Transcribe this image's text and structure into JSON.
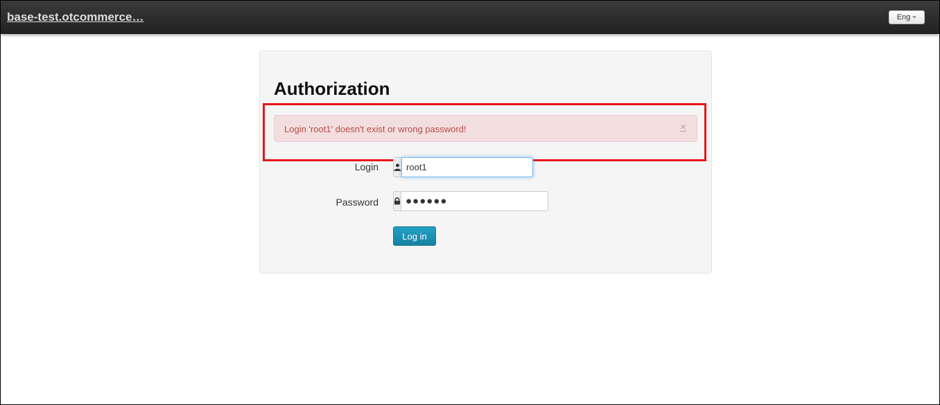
{
  "header": {
    "brand": "base-test.otcommerce…",
    "language": "Eng",
    "language_icon": "caret-down-icon"
  },
  "form": {
    "title": "Authorization",
    "alert": {
      "message": "Login 'root1' doesn't exist or wrong password!",
      "close": "×",
      "close_icon": "close-icon"
    },
    "login": {
      "label": "Login",
      "value": "root1",
      "icon": "user-icon"
    },
    "password": {
      "label": "Password",
      "value": "●●●●●●",
      "icon": "lock-icon"
    },
    "submit_label": "Log in"
  },
  "colors": {
    "alert_text": "#b94a48",
    "alert_background": "#f2dede",
    "highlight_border": "#e8141a",
    "button": "#1b8fb4",
    "navbar": "#2f2f2f"
  }
}
